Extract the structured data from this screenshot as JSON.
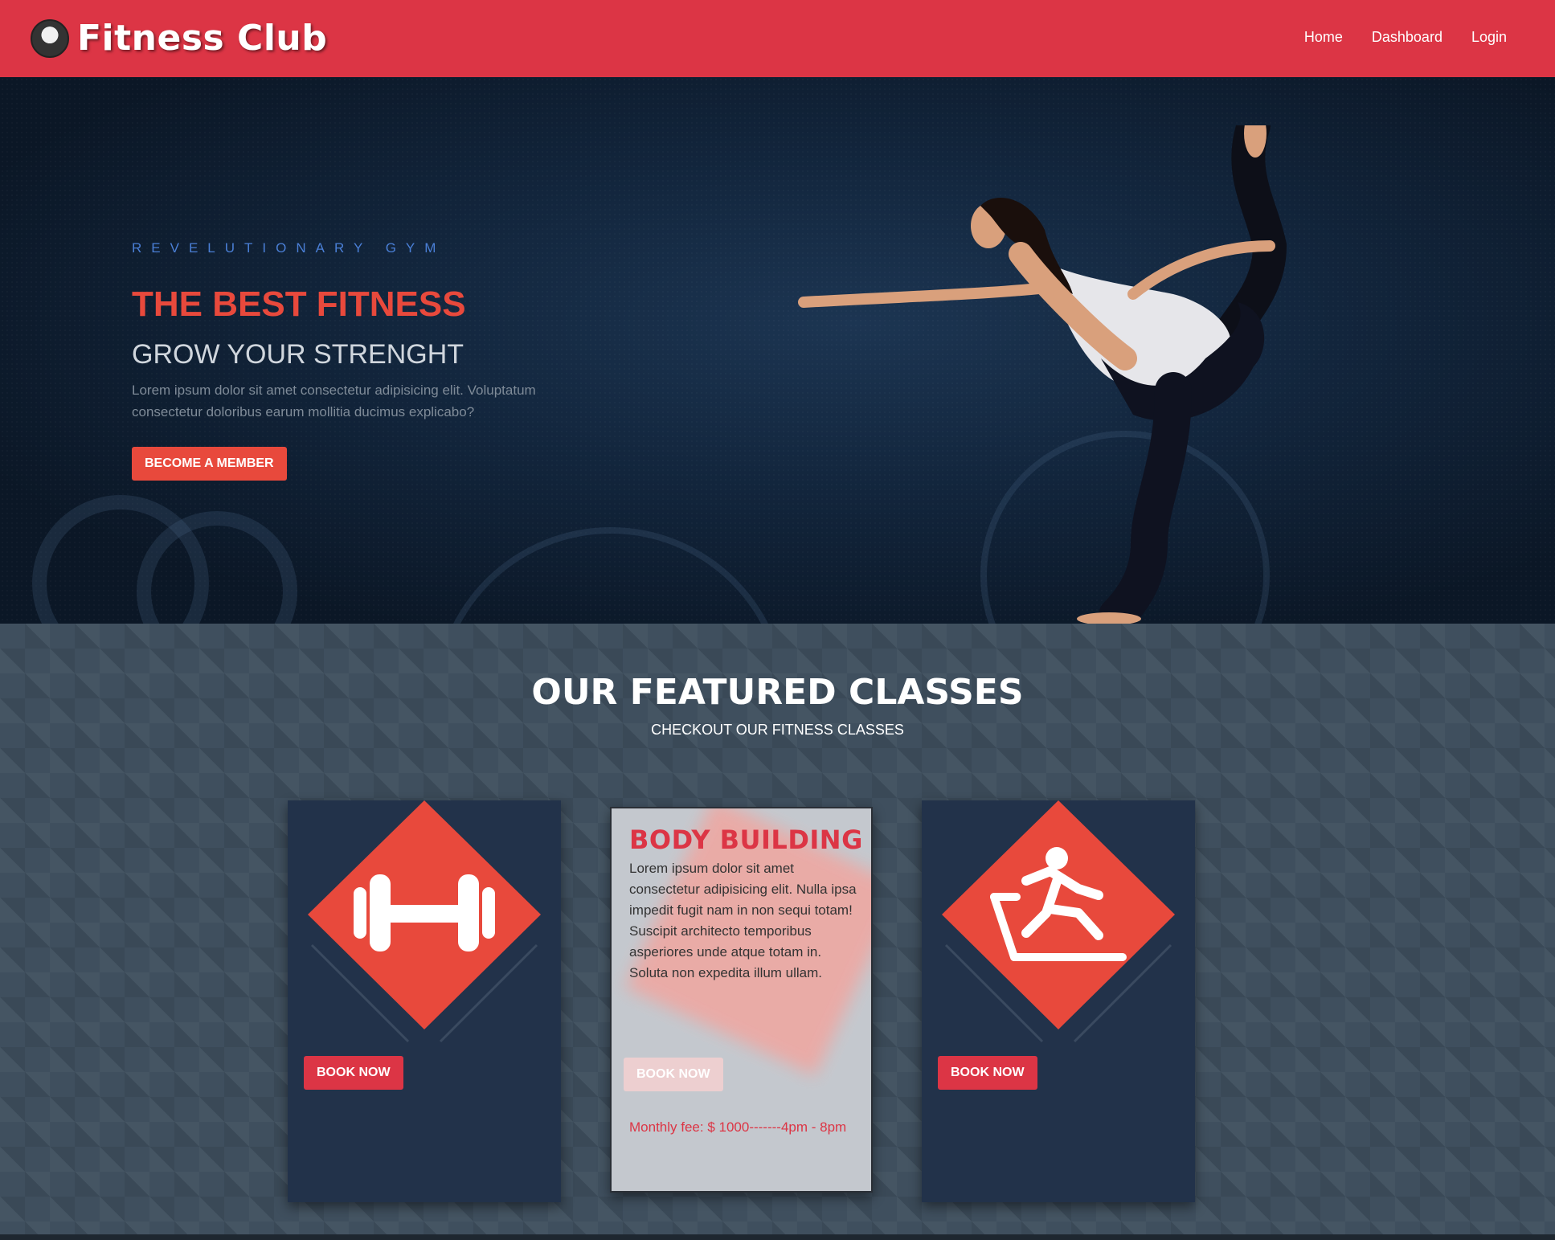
{
  "navbar": {
    "brand": "Fitness Club",
    "logo_text": "FITNESS CLUB",
    "links": [
      "Home",
      "Dashboard",
      "Login"
    ]
  },
  "hero": {
    "subtitle": "REVELUTIONARY GYM",
    "title": "THE BEST FITNESS",
    "tagline": "GROW YOUR STRENGHT",
    "text": "Lorem ipsum dolor sit amet consectetur adipisicing elit. Voluptatum consectetur doloribus earum mollitia ducimus explicabo?",
    "cta": "BECOME A MEMBER"
  },
  "classes": {
    "title": "OUR FEATURED CLASSES",
    "subtitle": "CHECKOUT OUR FITNESS CLASSES",
    "cards": [
      {
        "icon": "dumbbell-icon",
        "button": "BOOK NOW"
      },
      {
        "title": "BODY BUILDING",
        "description": "Lorem ipsum dolor sit amet consectetur adipisicing elit. Nulla ipsa impedit fugit nam in non sequi totam! Suscipit architecto temporibus asperiores unde atque totam in. Soluta non expedita illum ullam.",
        "button": "BOOK NOW",
        "fee": "Monthly fee: $ 1000-------4pm - 8pm"
      },
      {
        "icon": "treadmill-runner-icon",
        "button": "BOOK NOW"
      }
    ]
  },
  "colors": {
    "primary": "#dc3545",
    "accent": "#e8493c",
    "hero_bg": "#12253c",
    "card_bg": "#22324a"
  }
}
